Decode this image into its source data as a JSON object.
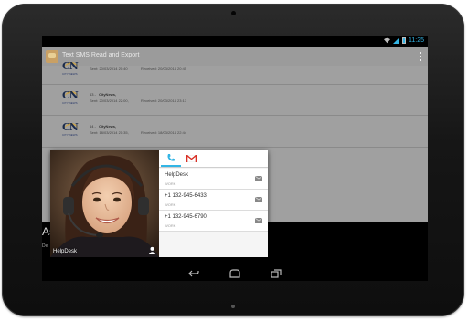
{
  "status_bar": {
    "time": "11:25"
  },
  "app": {
    "title": "Text SMS Read and Export"
  },
  "messages": [
    {
      "number": "",
      "sender": "",
      "sent": "Sent: 20/03/2014 20:40",
      "received": "Received: 20/03/2014 20:45",
      "logo_text": "CN",
      "logo_caption": "CITY NEWS"
    },
    {
      "number": "63 -",
      "sender": "CityNews,",
      "sent": "Sent: 20/03/2014 22:00,",
      "received": "Received: 20/03/2014 23:13",
      "logo_text": "CN",
      "logo_caption": "CITY NEWS"
    },
    {
      "number": "64 -",
      "sender": "CityNews,",
      "sent": "Sent: 18/03/2014 21:35,",
      "received": "Received: 18/03/2014 22:44",
      "logo_text": "CN",
      "logo_caption": "CITY NEWS"
    }
  ],
  "background_banner": {
    "line1": "As",
    "line2": "De"
  },
  "quick_contact": {
    "name": "HelpDesk",
    "tabs": [
      {
        "icon": "phone-icon",
        "active": true
      },
      {
        "icon": "gmail-icon",
        "active": false
      }
    ],
    "entries": [
      {
        "value": "HelpDesk",
        "type": "WORK"
      },
      {
        "value": "+1 132-945-6433",
        "type": "WORK"
      },
      {
        "value": "+1 132-945-6790",
        "type": "WORK"
      }
    ]
  },
  "colors": {
    "accent": "#33b5e5",
    "gmail_red": "#d93025",
    "action_bar": "#9b9b9b"
  },
  "nav_buttons": [
    "back-icon",
    "home-icon",
    "recents-icon"
  ]
}
